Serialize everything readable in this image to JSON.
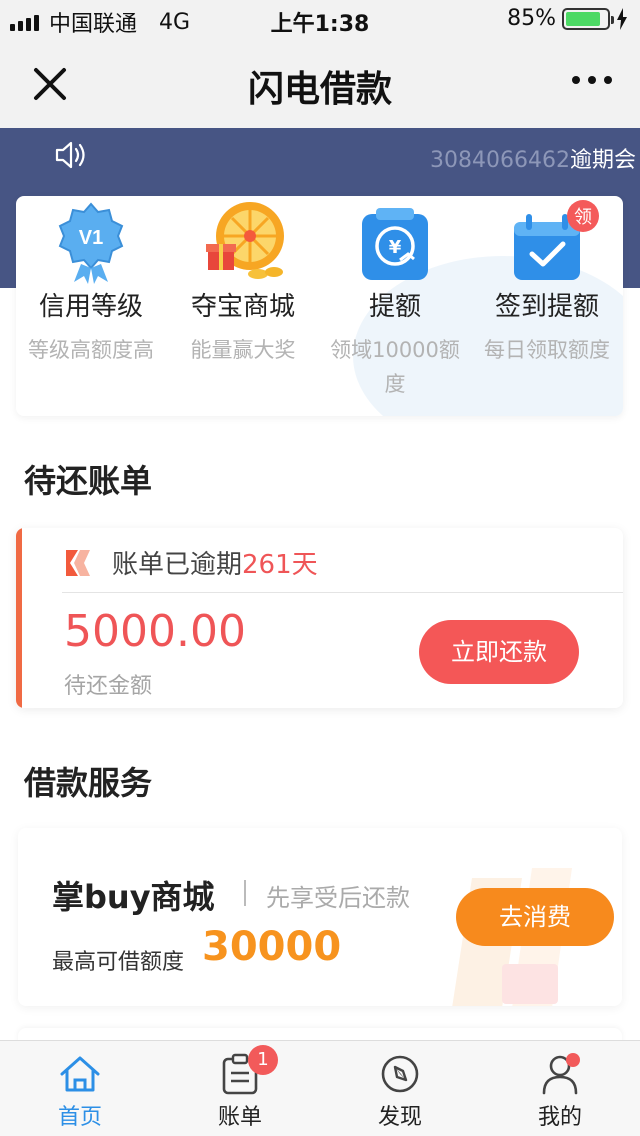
{
  "status_bar": {
    "carrier": "中国联通",
    "network": "4G",
    "time": "上午1:38",
    "battery": "85%",
    "battery_level": 0.85
  },
  "nav": {
    "title": "闪电借款"
  },
  "notice": {
    "text_gray": "3084066462",
    "text_white": "逾期会"
  },
  "quick_items": [
    {
      "title": "信用等级",
      "subtitle": "等级高额度高",
      "icon": "v1-badge-icon",
      "badge_text": "V1"
    },
    {
      "title": "夺宝商城",
      "subtitle": "能量赢大奖",
      "icon": "prize-wheel-icon"
    },
    {
      "title": "提额",
      "subtitle": "领域10000额度",
      "icon": "yuan-clipboard-icon"
    },
    {
      "title": "签到提额",
      "subtitle": "每日领取额度",
      "icon": "calendar-check-icon",
      "badge_text": "领"
    }
  ],
  "pending": {
    "section_title": "待还账单",
    "overdue_prefix": "账单已逾期",
    "overdue_days": "261天",
    "amount": "5000.00",
    "amount_label": "待还金额",
    "repay_button": "立即还款"
  },
  "loan_service": {
    "section_title": "借款服务",
    "name": "掌buy商城",
    "slogan": "先享受后还款",
    "limit_label": "最高可借额度",
    "limit_value": "30000",
    "button": "去消费"
  },
  "tabs": [
    {
      "label": "首页",
      "icon": "home-icon",
      "active": true
    },
    {
      "label": "账单",
      "icon": "bill-icon",
      "badge": "1"
    },
    {
      "label": "发现",
      "icon": "compass-icon"
    },
    {
      "label": "我的",
      "icon": "user-icon"
    }
  ],
  "colors": {
    "band": "#475584",
    "accent_red": "#ef5557",
    "accent_orange": "#f78a1d",
    "tab_active": "#2c8fe6"
  }
}
